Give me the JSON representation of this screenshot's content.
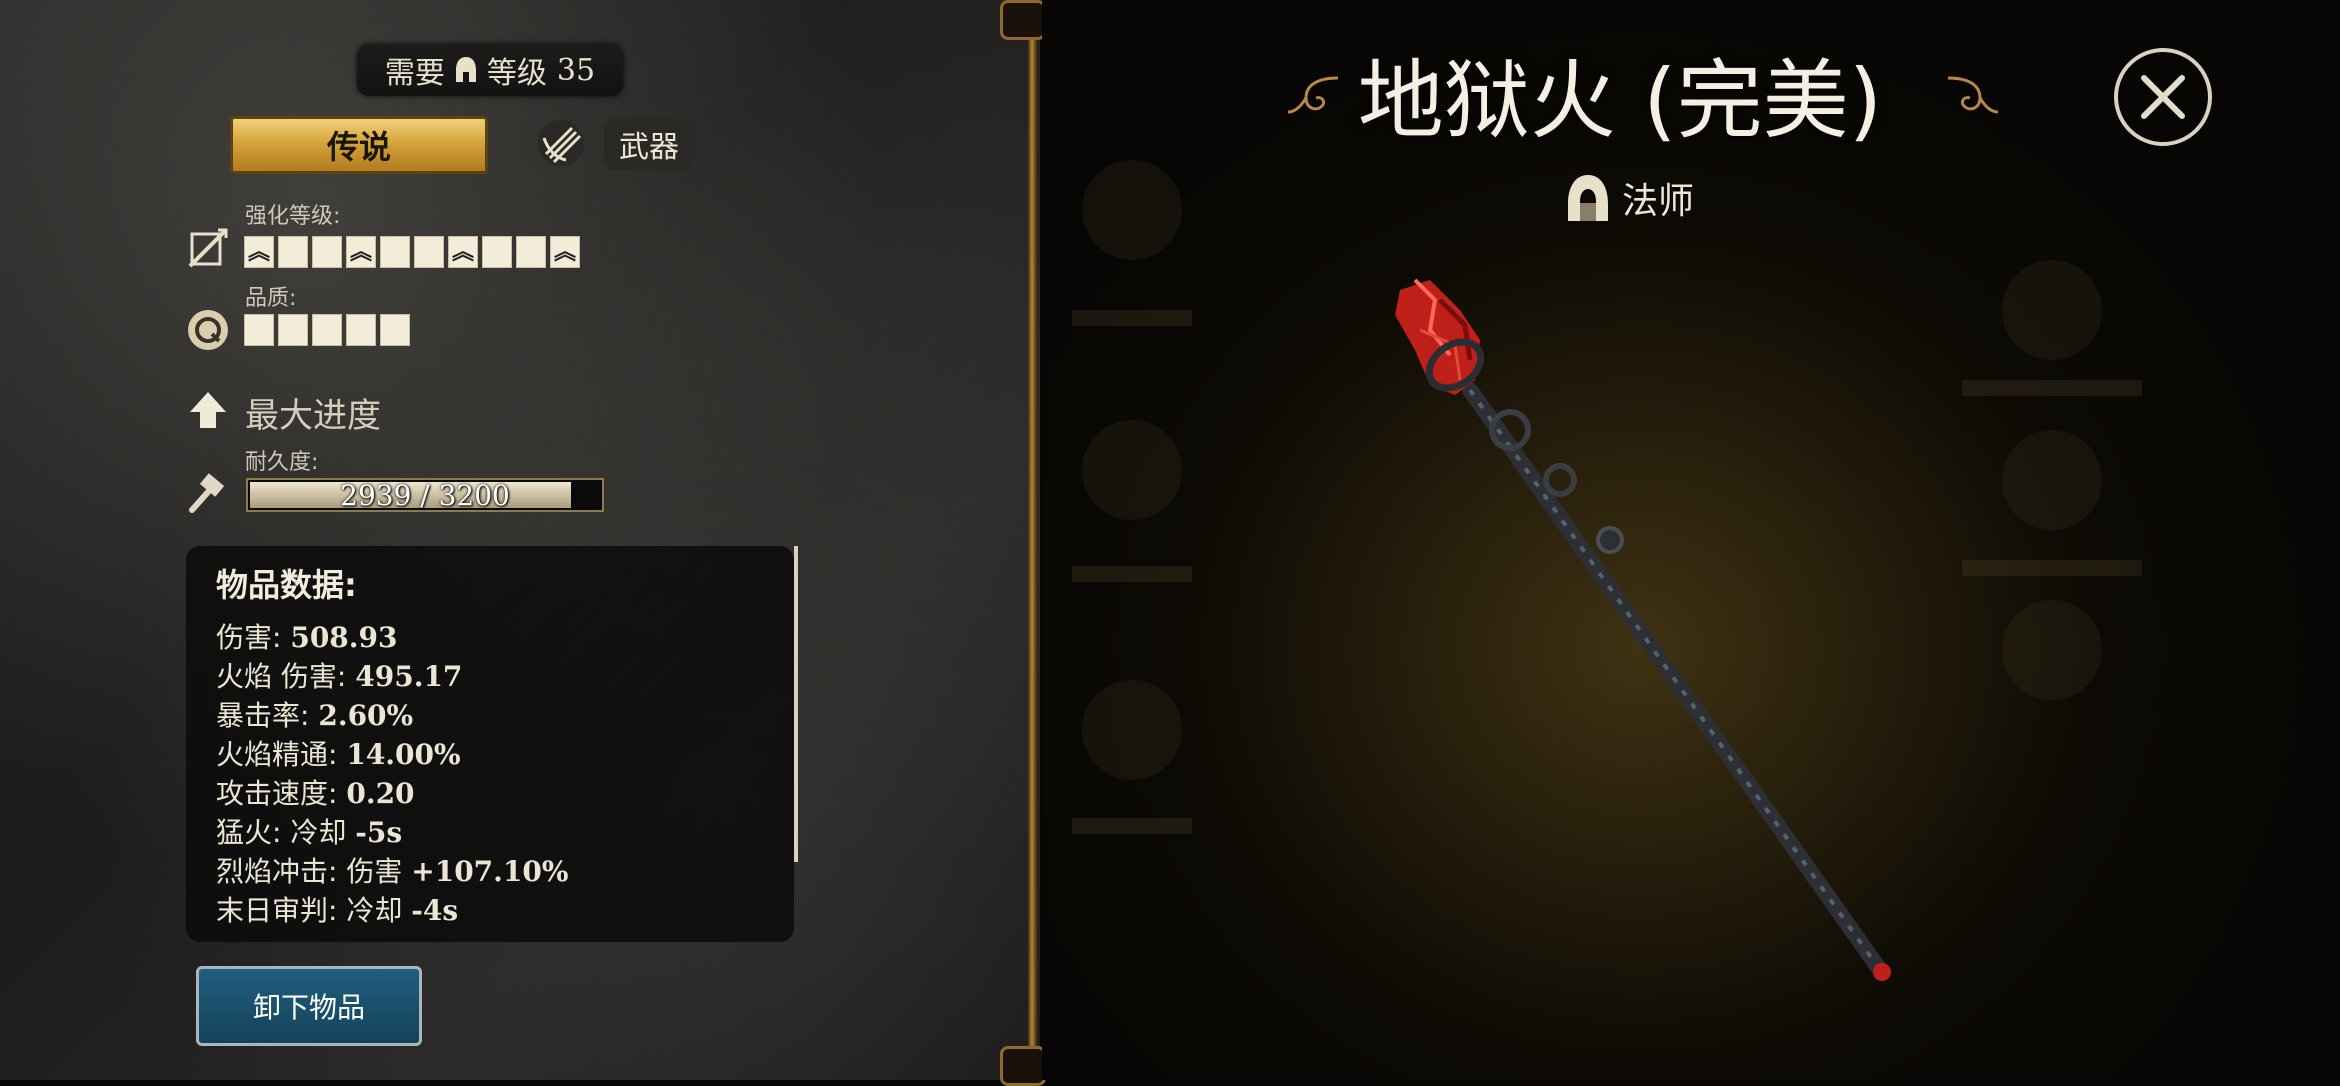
{
  "requirement": {
    "prefix": "需要",
    "level_label": "等级",
    "level": "35"
  },
  "rarity": "传说",
  "item_type": "武器",
  "upgrade": {
    "label": "强化等级:",
    "cells": [
      true,
      false,
      false,
      true,
      false,
      false,
      true,
      false,
      false,
      true
    ]
  },
  "quality": {
    "label": "品质:",
    "cells": 5
  },
  "max_progress": "最大进度",
  "durability": {
    "label": "耐久度:",
    "text": "2939 / 3200",
    "fraction": 0.918
  },
  "stats": {
    "title": "物品数据:",
    "lines": [
      {
        "name": "伤害: ",
        "value": "508.93"
      },
      {
        "name": "火焰 伤害: ",
        "value": "495.17"
      },
      {
        "name": "暴击率: ",
        "value": "2.60%"
      },
      {
        "name": "火焰精通: ",
        "value": "14.00%"
      },
      {
        "name": "攻击速度: ",
        "value": "0.20"
      },
      {
        "name": "猛火: 冷却 ",
        "value": "-5s"
      },
      {
        "name": "烈焰冲击: 伤害 ",
        "value": "+107.10%"
      },
      {
        "name": "末日审判: 冷却 ",
        "value": "-4s"
      }
    ]
  },
  "unequip_label": "卸下物品",
  "item_name": "地狱火 (完美)",
  "class_name": "法师",
  "colors": {
    "gold": "#d6a43c",
    "button_blue": "#1f5f7e",
    "crystal_red": "#c0201a"
  }
}
